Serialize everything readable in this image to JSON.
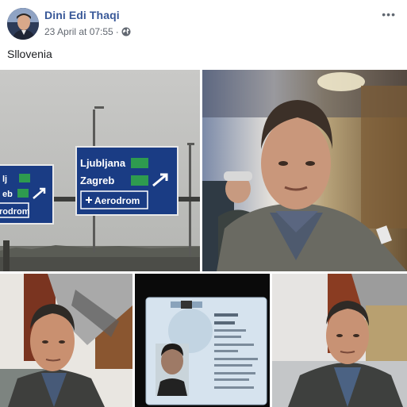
{
  "post": {
    "author": "Dini Edi Thaqi",
    "timestamp": "23 April at 07:55",
    "separator": "·",
    "privacy_icon": "globe-icon",
    "more_label": "•••",
    "text": "Sllovenia"
  },
  "photos": {
    "sign_left": {
      "line1": "lj",
      "line2": "eb",
      "aerodrom": "rodrom"
    },
    "sign_main": {
      "city1": "Ljubljana",
      "city2": "Zagreb",
      "aerodrom": "Aerodrom"
    }
  },
  "colors": {
    "link": "#385898",
    "meta": "#616770",
    "sign_blue": "#1a3c84",
    "motorway_green": "#2e9b4f"
  }
}
